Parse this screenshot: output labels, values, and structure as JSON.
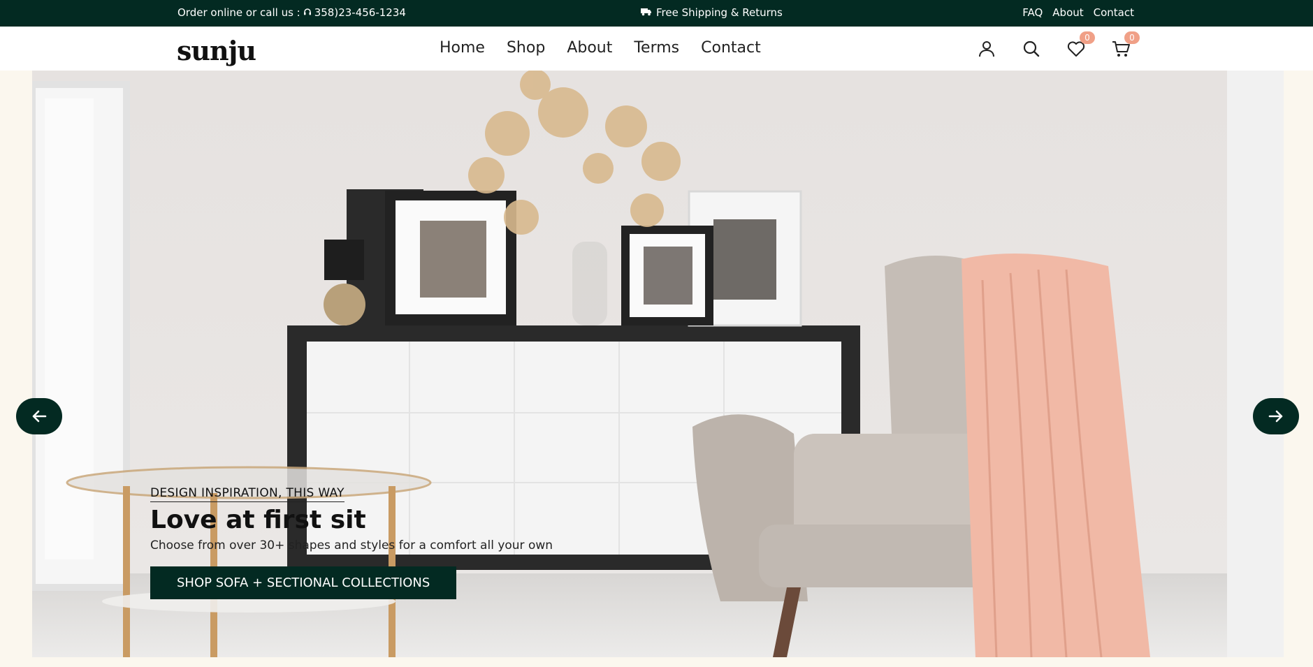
{
  "topbar": {
    "order_text": "Order online or call us : ",
    "phone": "358)23-456-1234",
    "shipping": "Free Shipping & Returns",
    "links": [
      "FAQ",
      "About",
      "Contact"
    ]
  },
  "header": {
    "logo": "sunju",
    "nav": [
      "Home",
      "Shop",
      "About",
      "Terms",
      "Contact"
    ],
    "wishlist_count": "0",
    "cart_count": "0"
  },
  "hero": {
    "eyebrow": "DESIGN INSPIRATION, THIS WAY",
    "headline": "Love at first sit",
    "subtext": "Choose from over 30+ shapes and styles for a comfort all your own",
    "cta": "SHOP SOFA + SECTIONAL COLLECTIONS"
  },
  "colors": {
    "brand_dark": "#032a22",
    "badge": "#f0a087",
    "page_bg": "#fbf7ee"
  }
}
